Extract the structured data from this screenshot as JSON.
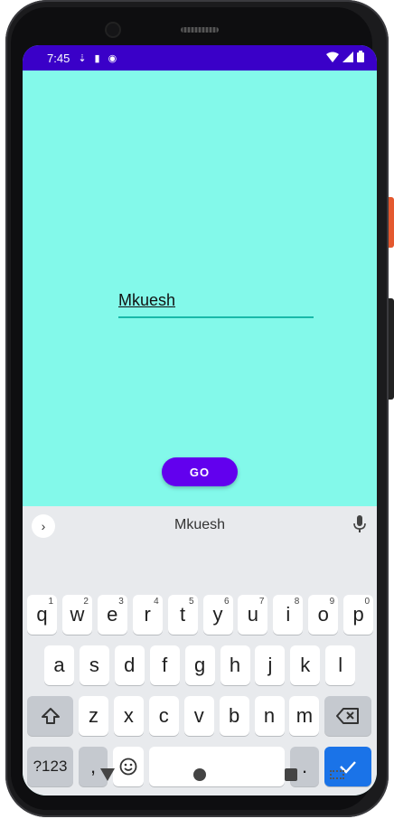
{
  "status": {
    "time": "7:45",
    "left_icons": [
      "download-icon",
      "sd-card-icon",
      "record-icon"
    ],
    "right_icons": [
      "wifi-icon",
      "signal-icon",
      "battery-icon"
    ]
  },
  "app": {
    "background": "#83f9ea",
    "name_field_value": "Mkuesh",
    "go_button_label": "GO"
  },
  "keyboard": {
    "suggestion": "Mkuesh",
    "row1": [
      {
        "label": "q",
        "sup": "1"
      },
      {
        "label": "w",
        "sup": "2"
      },
      {
        "label": "e",
        "sup": "3"
      },
      {
        "label": "r",
        "sup": "4"
      },
      {
        "label": "t",
        "sup": "5"
      },
      {
        "label": "y",
        "sup": "6"
      },
      {
        "label": "u",
        "sup": "7"
      },
      {
        "label": "i",
        "sup": "8"
      },
      {
        "label": "o",
        "sup": "9"
      },
      {
        "label": "p",
        "sup": "0"
      }
    ],
    "row2": [
      "a",
      "s",
      "d",
      "f",
      "g",
      "h",
      "j",
      "k",
      "l"
    ],
    "row3": [
      "z",
      "x",
      "c",
      "v",
      "b",
      "n",
      "m"
    ],
    "symbols_label": "?123",
    "comma_label": ",",
    "period_label": ".",
    "accent_color": "#1a73e8"
  }
}
